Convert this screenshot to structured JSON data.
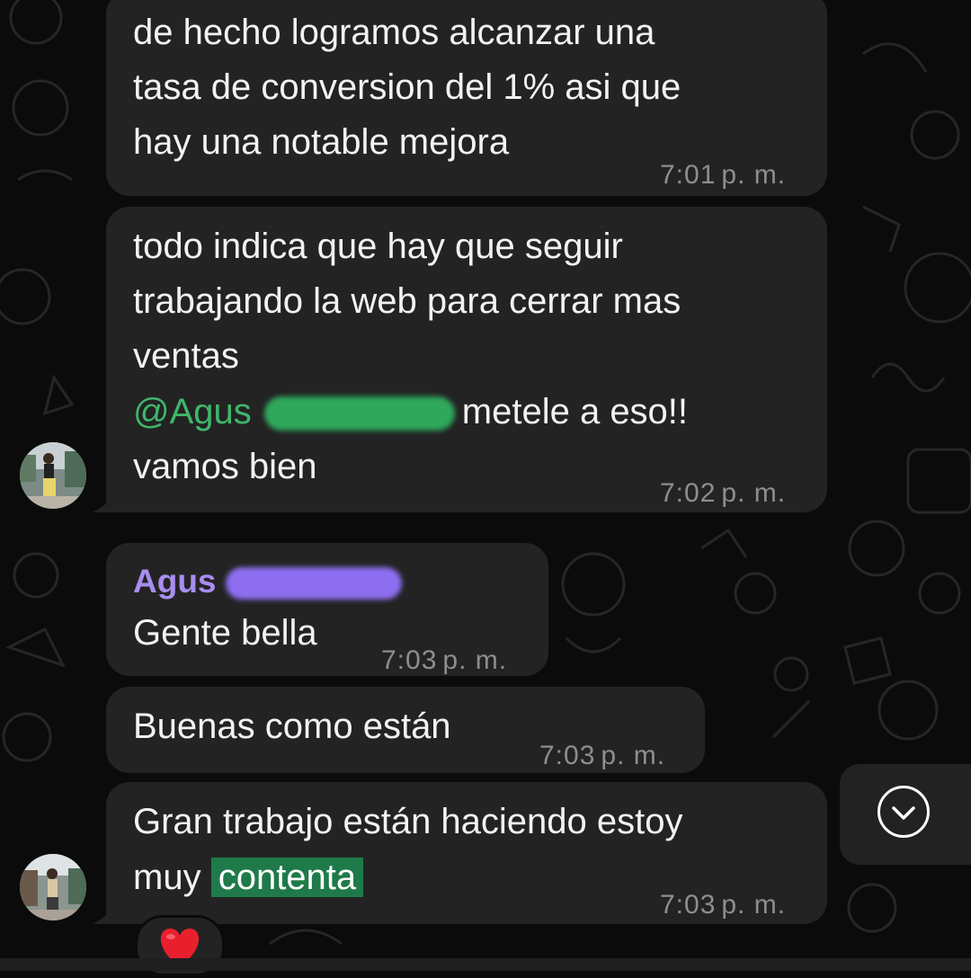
{
  "messages": [
    {
      "lines": [
        "de hecho logramos alcanzar una",
        "tasa de conversion del 1% asi que",
        "hay una notable mejora"
      ],
      "time": "7:01",
      "ampm": "p. m."
    },
    {
      "lines": [
        "todo indica que hay que seguir",
        "trabajando la web para cerrar mas",
        "ventas"
      ],
      "mention": "@Agus",
      "after_mention": "metele a eso!!",
      "last_line": "vamos bien",
      "time": "7:02",
      "ampm": "p. m."
    },
    {
      "sender": "Agus",
      "text": "Gente bella",
      "time": "7:03",
      "ampm": "p. m."
    },
    {
      "text": "Buenas como están",
      "time": "7:03",
      "ampm": "p. m."
    },
    {
      "line1": "Gran trabajo están haciendo estoy",
      "line2_prefix": "muy",
      "highlight": "contenta",
      "time": "7:03",
      "ampm": "p. m."
    }
  ],
  "reaction": "❤️",
  "colors": {
    "background": "#0b0b0b",
    "bubble": "#232323",
    "mention": "#3fb66b",
    "sender_name": "#a88df0",
    "timestamp": "#8e8e8e",
    "highlight": "#1f7a4a"
  },
  "icons": [
    "chevron-down-icon",
    "heart-icon",
    "avatar"
  ]
}
